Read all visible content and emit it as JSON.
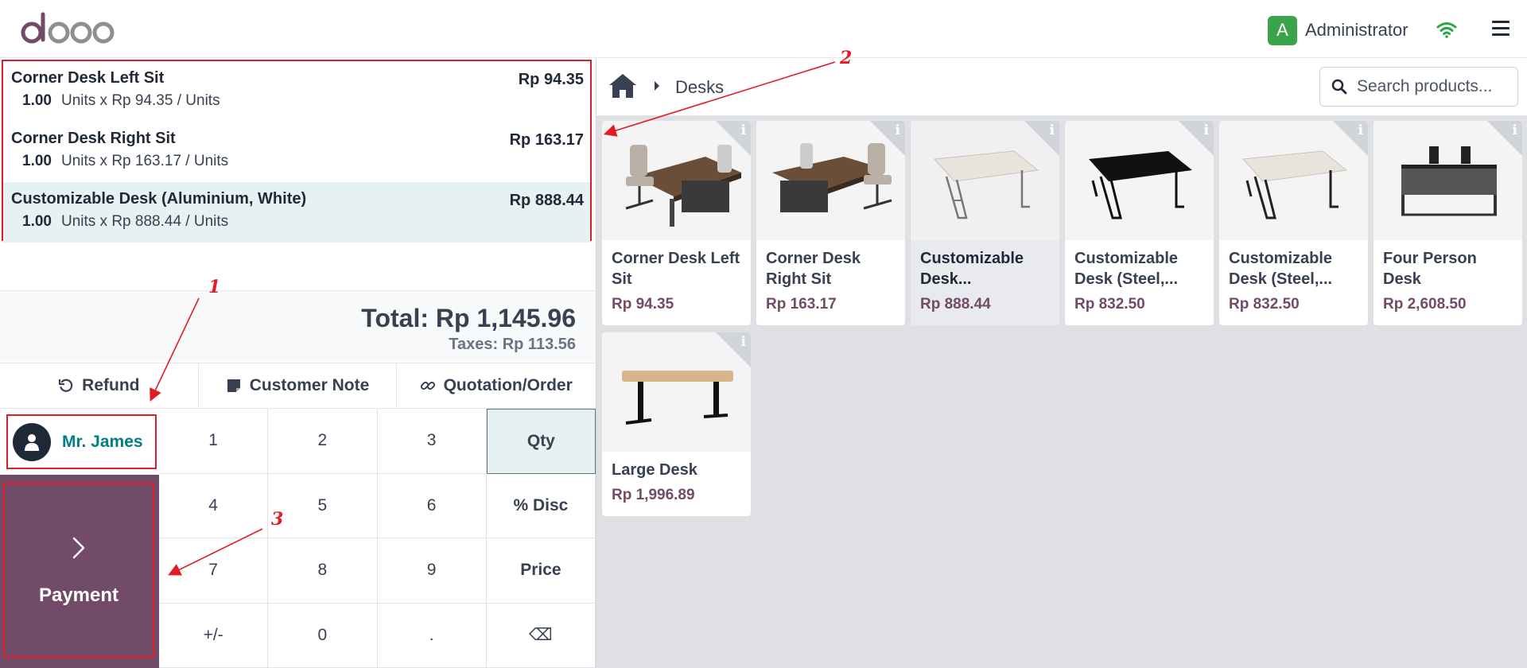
{
  "app": {
    "brand": "odoo",
    "accent": "#714b67",
    "teal": "#017e84"
  },
  "header": {
    "user_initial": "A",
    "user_name": "Administrator",
    "icons": [
      "wifi-icon",
      "menu-icon"
    ]
  },
  "order": {
    "lines": [
      {
        "name": "Corner Desk Left Sit",
        "price": "Rp 94.35",
        "qty": "1.00",
        "detail": "Units x Rp 94.35 / Units",
        "selected": false
      },
      {
        "name": "Corner Desk Right Sit",
        "price": "Rp 163.17",
        "qty": "1.00",
        "detail": "Units x Rp 163.17 / Units",
        "selected": false
      },
      {
        "name": "Customizable Desk (Aluminium, White)",
        "price": "Rp 888.44",
        "qty": "1.00",
        "detail": "Units x Rp 888.44 / Units",
        "selected": true
      }
    ],
    "total": "Total: Rp 1,145.96",
    "taxes": "Taxes: Rp 113.56"
  },
  "actions": {
    "refund": "Refund",
    "customer_note": "Customer Note",
    "quotation": "Quotation/Order"
  },
  "customer": {
    "name": "Mr. James"
  },
  "payment": {
    "label": "Payment"
  },
  "numpad": {
    "keys": [
      "1",
      "2",
      "3",
      "Qty",
      "4",
      "5",
      "6",
      "% Disc",
      "7",
      "8",
      "9",
      "Price",
      "+/-",
      "0",
      ".",
      "⌫"
    ],
    "active": "Qty"
  },
  "breadcrumb": {
    "category": "Desks"
  },
  "search": {
    "placeholder": "Search products..."
  },
  "products": [
    {
      "name": "Corner Desk Left Sit",
      "price": "Rp 94.35"
    },
    {
      "name": "Corner Desk Right Sit",
      "price": "Rp 163.17"
    },
    {
      "name": "Customizable Desk...",
      "price": "Rp 888.44",
      "highlighted": true
    },
    {
      "name": "Customizable Desk (Steel,...",
      "price": "Rp 832.50"
    },
    {
      "name": "Customizable Desk (Steel,...",
      "price": "Rp 832.50"
    },
    {
      "name": "Four Person Desk",
      "price": "Rp 2,608.50"
    },
    {
      "name": "Large Desk",
      "price": "Rp 1,996.89"
    }
  ],
  "annotations": [
    "1",
    "2",
    "3"
  ]
}
